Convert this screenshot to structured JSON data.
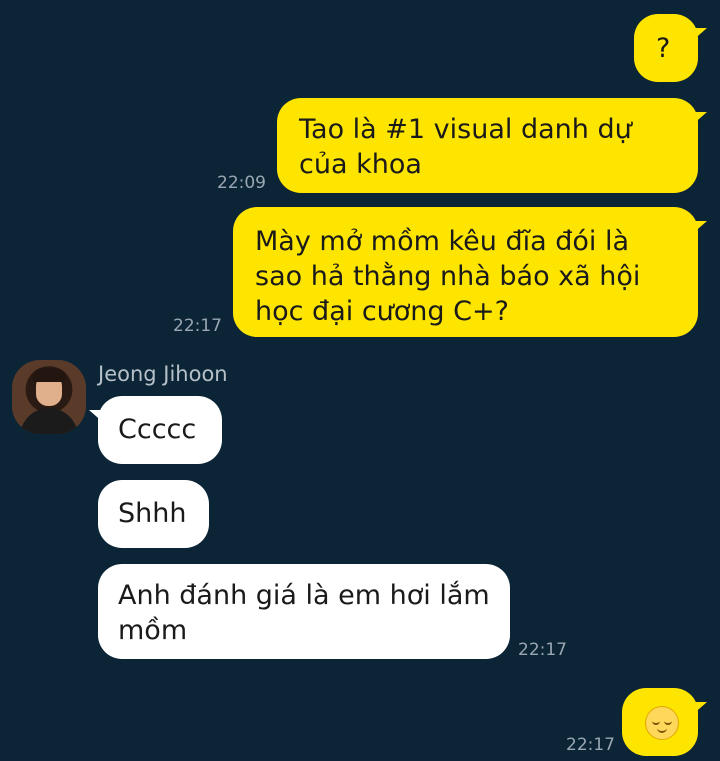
{
  "chat": {
    "messages": [
      {
        "side": "me",
        "text": "?"
      },
      {
        "side": "me",
        "text": "Tao là #1 visual danh dự của khoa",
        "time": "22:09"
      },
      {
        "side": "me",
        "text": "Mày mở mồm kêu đĩa đói là sao hả thằng nhà báo xã hội học đại cương C+?",
        "time": "22:17"
      },
      {
        "side": "them",
        "text": "Ccccc"
      },
      {
        "side": "them",
        "text": "Shhh"
      },
      {
        "side": "them",
        "text": "Anh đánh giá là em hơi lắm mồm",
        "time": "22:17"
      },
      {
        "side": "me",
        "emoji": "relieved-sparkle-emoji",
        "time": "22:17"
      }
    ],
    "sender_name": "Jeong Jihoon"
  },
  "colors": {
    "background": "#0b2436",
    "my_bubble": "#fee500",
    "their_bubble": "#ffffff",
    "timestamp": "#9aa7b2"
  }
}
